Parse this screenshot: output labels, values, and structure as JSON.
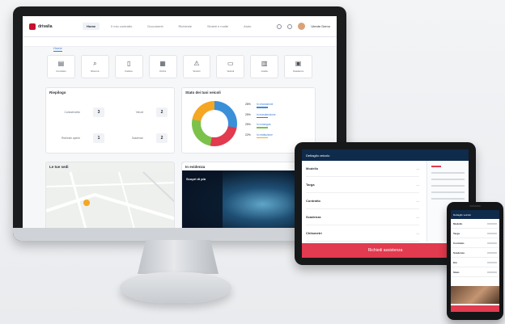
{
  "colors": {
    "brand": "#c8102e",
    "accent_blue": "#3a7bd5",
    "cta_red": "#e23a4e",
    "navy": "#0f2b4c",
    "donut": [
      "#3a8fd9",
      "#e23a4e",
      "#7cc24a",
      "#f5a623"
    ]
  },
  "desktop": {
    "logo_text": "drivalia",
    "nav": [
      {
        "label": "Home"
      },
      {
        "label": "Il mio contratto"
      },
      {
        "label": "Documenti"
      },
      {
        "label": "Richieste"
      },
      {
        "label": "Sinistri e multe"
      },
      {
        "label": "Aiuto"
      }
    ],
    "user_name": "Utente Demo",
    "breadcrumb": "Home",
    "tiles": [
      {
        "icon": "document-icon",
        "glyph": "▤",
        "label": "Contratto"
      },
      {
        "icon": "search-icon",
        "glyph": "⌕",
        "label": "Ricerca"
      },
      {
        "icon": "file-icon",
        "glyph": "▯",
        "label": "Fatture"
      },
      {
        "icon": "clipboard-icon",
        "glyph": "▦",
        "label": "Ordini"
      },
      {
        "icon": "warning-icon",
        "glyph": "⚠",
        "label": "Sinistri"
      },
      {
        "icon": "car-icon",
        "glyph": "▭",
        "label": "Veicoli"
      },
      {
        "icon": "book-icon",
        "glyph": "▥",
        "label": "Guida"
      },
      {
        "icon": "calendar-icon",
        "glyph": "▣",
        "label": "Scadenze"
      }
    ],
    "stats_panel": {
      "title": "Riepilogo",
      "items": [
        {
          "label": "Contratti attivi",
          "value": "3"
        },
        {
          "label": "Veicoli",
          "value": "2"
        },
        {
          "label": "Richieste aperte",
          "value": "1"
        },
        {
          "label": "Scadenze",
          "value": "2"
        }
      ]
    },
    "donut_panel": {
      "title": "Stato dei tuoi veicoli",
      "legend": [
        {
          "pct": "28%",
          "label": "In circolazione"
        },
        {
          "pct": "25%",
          "label": "In manutenzione"
        },
        {
          "pct": "25%",
          "label": "In consegna"
        },
        {
          "pct": "22%",
          "label": "In restituzione"
        }
      ]
    },
    "map_panel": {
      "title": "Le tue sedi"
    },
    "hero_panel": {
      "title": "In evidenza",
      "headline": "Scopri di più"
    }
  },
  "tablet": {
    "header": "Dettaglio veicolo",
    "rows": [
      {
        "label": "Modello",
        "value": "—"
      },
      {
        "label": "Targa",
        "value": "—"
      },
      {
        "label": "Contratto",
        "value": "—"
      },
      {
        "label": "Scadenza",
        "value": "—"
      },
      {
        "label": "Chilometri",
        "value": "—"
      }
    ],
    "cta": "Richiedi assistenza"
  },
  "phone": {
    "header": "Dettaglio veicolo",
    "rows": [
      {
        "label": "Modello"
      },
      {
        "label": "Targa"
      },
      {
        "label": "Contratto"
      },
      {
        "label": "Scadenza"
      },
      {
        "label": "Km"
      },
      {
        "label": "Stato"
      }
    ]
  }
}
